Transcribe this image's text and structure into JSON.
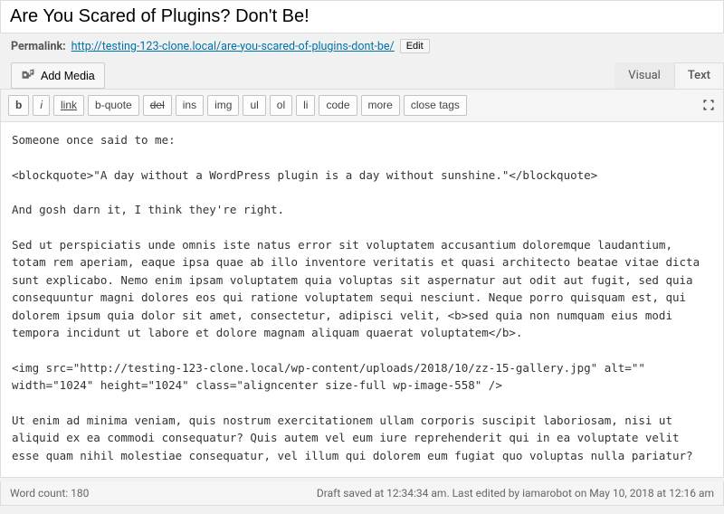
{
  "title": "Are You Scared of Plugins? Don't Be!",
  "permalink": {
    "label": "Permalink:",
    "base": "http://testing-123-clone.local/",
    "slug": "are-you-scared-of-plugins-dont-be/",
    "edit": "Edit"
  },
  "addmedia": "Add Media",
  "tabs": {
    "visual": "Visual",
    "text": "Text"
  },
  "qt": {
    "b": "b",
    "i": "i",
    "link": "link",
    "bquote": "b-quote",
    "del": "del",
    "ins": "ins",
    "img": "img",
    "ul": "ul",
    "ol": "ol",
    "li": "li",
    "code": "code",
    "more": "more",
    "close": "close tags"
  },
  "content": "Someone once said to me:\n\n<blockquote>\"A day without a WordPress plugin is a day without sunshine.\"</blockquote>\n\nAnd gosh darn it, I think they're right.\n\nSed ut perspiciatis unde omnis iste natus error sit voluptatem accusantium doloremque laudantium, totam rem aperiam, eaque ipsa quae ab illo inventore veritatis et quasi architecto beatae vitae dicta sunt explicabo. Nemo enim ipsam voluptatem quia voluptas sit aspernatur aut odit aut fugit, sed quia consequuntur magni dolores eos qui ratione voluptatem sequi nesciunt. Neque porro quisquam est, qui dolorem ipsum quia dolor sit amet, consectetur, adipisci velit, <b>sed quia non numquam eius modi tempora incidunt ut labore et dolore magnam aliquam quaerat voluptatem</b>.\n\n<img src=\"http://testing-123-clone.local/wp-content/uploads/2018/10/zz-15-gallery.jpg\" alt=\"\" width=\"1024\" height=\"1024\" class=\"aligncenter size-full wp-image-558\" />\n\nUt enim ad minima veniam, quis nostrum exercitationem ullam corporis suscipit laboriosam, nisi ut aliquid ex ea commodi consequatur? Quis autem vel eum iure reprehenderit qui in ea voluptate velit esse quam nihil molestiae consequatur, vel illum qui dolorem eum fugiat quo voluptas nulla pariatur?\n\nNam libero tempore, cum soluta nobis est eligendi optio cumque nihil impedit quo:\n<ul>\n \t<li>minus id quod maxime placeat facere possimus</li>\n \t<li>omnis voluptas assumenda est</li>\n \t<li>omnis dolor repellendus.</li>\n</ul>",
  "status": {
    "wordcount": "Word count: 180",
    "saved": "Draft saved at 12:34:34 am. Last edited by iamarobot on May 10, 2018 at 12:16 am"
  }
}
